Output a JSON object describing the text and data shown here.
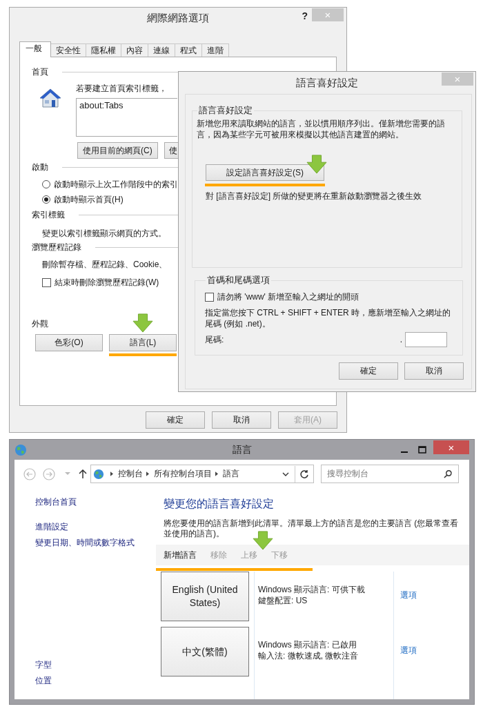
{
  "internet_options": {
    "title": "網際網路選項",
    "help": "?",
    "close": "×",
    "tabs": [
      {
        "label": "一般",
        "selected": true
      },
      {
        "label": "安全性",
        "selected": false
      },
      {
        "label": "隱私權",
        "selected": false
      },
      {
        "label": "內容",
        "selected": false
      },
      {
        "label": "連線",
        "selected": false
      },
      {
        "label": "程式",
        "selected": false
      },
      {
        "label": "進階",
        "selected": false
      }
    ],
    "home_page": {
      "heading": "首頁",
      "prompt": "若要建立首頁索引標籤，",
      "value": "about:Tabs",
      "buttons": [
        "使用目前的網頁(C)",
        "使"
      ]
    },
    "startup": {
      "heading": "啟動",
      "options": [
        {
          "label": "啟動時顯示上次工作階段中的索引",
          "selected": false
        },
        {
          "label": "啟動時顯示首頁(H)",
          "selected": true
        }
      ]
    },
    "tabs_section": {
      "heading": "索引標籤",
      "text": "變更以索引標籤顯示網頁的方式。"
    },
    "history": {
      "heading": "瀏覽歷程記錄",
      "text": "刪除暫存檔、歷程記錄、Cookie、",
      "checkbox": {
        "label": "結束時刪除瀏覽歷程記錄(W)",
        "checked": false
      }
    },
    "appearance": {
      "heading": "外觀",
      "buttons": [
        {
          "label": "色彩(O)",
          "highlighted": false
        },
        {
          "label": "語言(L)",
          "highlighted": true
        }
      ]
    },
    "footer_buttons": [
      {
        "label": "確定",
        "disabled": false
      },
      {
        "label": "取消",
        "disabled": false
      },
      {
        "label": "套用(A)",
        "disabled": true
      }
    ]
  },
  "language_preference": {
    "title": "語言喜好設定",
    "close": "×",
    "group": {
      "heading": "語言喜好設定",
      "description": "新增您用來讀取網站的語言，並以慣用順序列出。僅新增您需要的語言，因為某些字元可被用來模擬以其他語言建置的網站。",
      "button": {
        "label": "設定語言喜好設定(S)",
        "highlighted": true
      },
      "note": "對 [語言喜好設定] 所做的變更將在重新啟動瀏覽器之後生效"
    },
    "suffix_group": {
      "heading": "首碼和尾碼選項",
      "checkbox": {
        "label": "請勿將 'www' 新增至輸入之網址的開頭",
        "checked": false
      },
      "description": "指定當您按下 CTRL + SHIFT + ENTER 時，應新增至輸入之網址的尾碼 (例如 .net)。",
      "suffix_label": "尾碼:",
      "dot": "."
    },
    "buttons": [
      "確定",
      "取消"
    ]
  },
  "control_panel": {
    "title": "語言",
    "close": "×",
    "breadcrumb": [
      "控制台",
      "所有控制台項目",
      "語言"
    ],
    "search": {
      "placeholder": "搜尋控制台"
    },
    "sidebar_top": [
      "控制台首頁",
      "進階設定",
      "變更日期、時間或數字格式"
    ],
    "sidebar_bottom": [
      "字型",
      "位置"
    ],
    "heading": "變更您的語言喜好設定",
    "description": "將您要使用的語言新增到此清單。清單最上方的語言是您的主要語言 (您最常查看並使用的語言)。",
    "toolbar": {
      "highlighted": true,
      "items": [
        {
          "label": "新增語言",
          "disabled": false
        },
        {
          "label": "移除",
          "disabled": true
        },
        {
          "label": "上移",
          "disabled": true
        },
        {
          "label": "下移",
          "disabled": true
        }
      ]
    },
    "languages": [
      {
        "name": "English (United States)",
        "details": [
          "Windows 顯示語言: 可供下載",
          "鍵盤配置: US"
        ],
        "link": "選項"
      },
      {
        "name": "中文(繁體)",
        "details": [
          "Windows 顯示語言: 已啟用",
          "輸入法: 微軟速成, 微軟注音"
        ],
        "link": "選項"
      }
    ]
  }
}
